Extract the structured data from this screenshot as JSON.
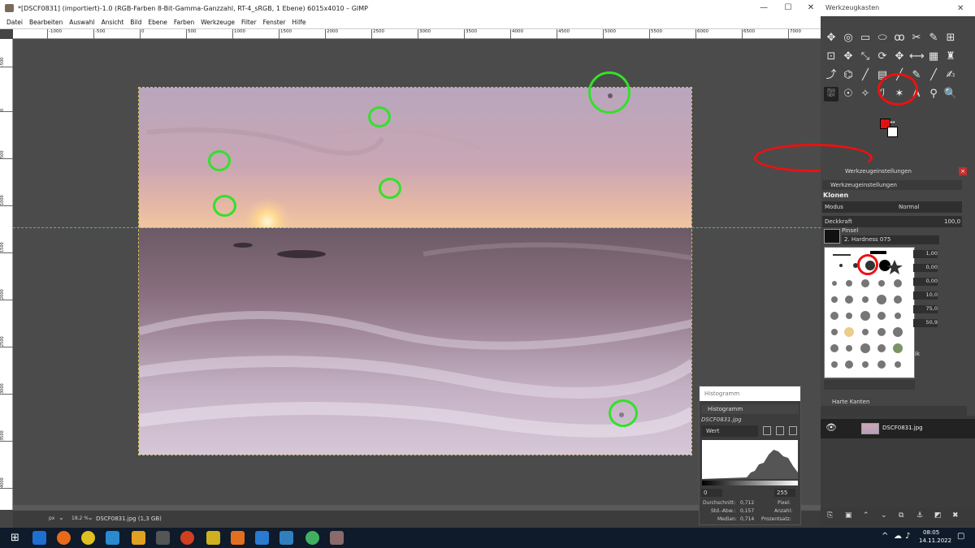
{
  "window": {
    "title": "*[DSCF0831] (importiert)-1.0 (RGB-Farben 8-Bit-Gamma-Ganzzahl, RT-4_sRGB, 1 Ebene) 6015x4010 – GIMP",
    "minimize": "—",
    "maximize": "☐",
    "close": "✕"
  },
  "menu": [
    "Datei",
    "Bearbeiten",
    "Auswahl",
    "Ansicht",
    "Bild",
    "Ebene",
    "Farben",
    "Werkzeuge",
    "Filter",
    "Fenster",
    "Hilfe"
  ],
  "ruler_top": [
    "-1000",
    "-500",
    "0",
    "500",
    "1000",
    "1500",
    "2000",
    "2500",
    "3000",
    "3500",
    "4000",
    "4500",
    "5000",
    "5500",
    "6000",
    "6500",
    "7000"
  ],
  "ruler_left": [
    "-500",
    "0",
    "500",
    "1000",
    "1500",
    "2000",
    "2500",
    "3000",
    "3500",
    "4000"
  ],
  "statusbar": {
    "unit": "px",
    "zoom": "18,2 %",
    "file": "DSCF0831.jpg (1,3 GB)"
  },
  "toolbox": {
    "title": "Werkzeugkasten",
    "close": "✕",
    "tools": [
      "✥",
      "◎",
      "▭",
      "⬭",
      "ꝏ",
      "✂",
      "✎",
      "⊞",
      "⊡",
      "✥",
      "⤡",
      "⟳",
      "✥",
      "⟷",
      "▦",
      "♜",
      "⤴",
      "⌬",
      "╱",
      "▤",
      "╱",
      "✎",
      "╱",
      "✍",
      "⛆",
      "☉",
      "✧",
      "ℐ",
      "✶",
      "A",
      "⚲",
      "🔍"
    ],
    "active_tool": "⛆"
  },
  "tool_options": {
    "panel_title": "Werkzeugeinstellungen",
    "tab_label": "Werkzeugeinstellungen",
    "tool_name": "Klonen",
    "mode_label": "Modus",
    "mode_value": "Normal",
    "opacity_label": "Deckkraft",
    "opacity_value": "100,0",
    "brush_label": "Pinsel",
    "brush_value": "2. Hardness 075",
    "values": [
      "1,00",
      "0,00",
      "0,00",
      "10,0",
      "75,0",
      "50,9"
    ],
    "hard_edges": "Harte Kanten",
    "ik": "ik"
  },
  "histogram": {
    "dock_title": "Histogramm",
    "tab_label": "Histogramm",
    "image_name": "DSCF0831.jpg",
    "channel": "Wert",
    "range_min": "0",
    "range_max": "255",
    "stats": [
      {
        "label": "Durchschnitt:",
        "value": "0,712",
        "label2": "Pixel:"
      },
      {
        "label": "Std.-Abw.:",
        "value": "0,157",
        "label2": "Anzahl:"
      },
      {
        "label": "Median:",
        "value": "0,714",
        "label2": "Prozentsatz:"
      }
    ]
  },
  "layers": {
    "layer_name": "DSCF0831.jpg"
  },
  "taskbar": {
    "time": "08:05",
    "date": "14.11.2022"
  },
  "colors": {
    "fg": "#e01010",
    "bg": "#ffffff",
    "annotation_green": "#33e02a",
    "annotation_red": "#ee1010",
    "guide": "#3fb6c8"
  }
}
